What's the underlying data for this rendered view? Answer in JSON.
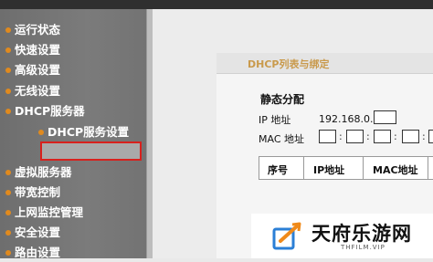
{
  "sidebar": {
    "items": [
      {
        "label": "运行状态"
      },
      {
        "label": "快速设置"
      },
      {
        "label": "高级设置"
      },
      {
        "label": "无线设置"
      },
      {
        "label": "DHCP服务器"
      },
      {
        "label": "DHCP服务设置"
      },
      {
        "label": "虚拟服务器"
      },
      {
        "label": "带宽控制"
      },
      {
        "label": "上网监控管理"
      },
      {
        "label": "安全设置"
      },
      {
        "label": "路由设置"
      }
    ]
  },
  "panel": {
    "title": "DHCP列表与绑定",
    "section_title": "静态分配",
    "ip_label": "IP 地址",
    "ip_prefix": "192.168.0.",
    "mac_label": "MAC 地址",
    "mac_separator": ":",
    "table_headers": [
      "序号",
      "IP地址",
      "MAC地址"
    ]
  },
  "watermark": {
    "logo": "tianfu-logo",
    "text": "天府乐游网",
    "subtext": "THFILM.VIP"
  },
  "colors": {
    "sidebar_bg": "#737373",
    "highlight_border": "#d8211d",
    "bullet": "#e08a1e",
    "panel_title": "#c99a4c"
  }
}
